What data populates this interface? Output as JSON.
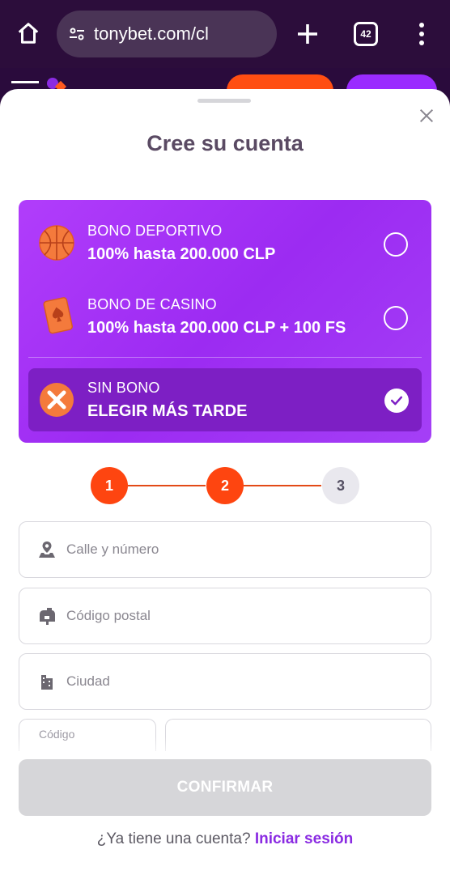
{
  "browser": {
    "url": "tonybet.com/cl",
    "tab_count": "42"
  },
  "modal": {
    "title": "Cree su cuenta"
  },
  "bonuses": [
    {
      "label": "BONO DEPORTIVO",
      "value": "100% hasta 200.000 CLP",
      "icon": "basketball-icon",
      "selected": false
    },
    {
      "label": "BONO DE CASINO",
      "value": "100% hasta 200.000 CLP + 100 FS",
      "icon": "playing-card-icon",
      "selected": false
    },
    {
      "label": "SIN BONO",
      "value": "ELEGIR MÁS TARDE",
      "icon": "no-bonus-icon",
      "selected": true
    }
  ],
  "stepper": {
    "steps": [
      "1",
      "2",
      "3"
    ],
    "current": 2
  },
  "form": {
    "street_placeholder": "Calle y número",
    "postal_placeholder": "Código postal",
    "city_placeholder": "Ciudad",
    "code_label": "Código"
  },
  "footer": {
    "confirm_label": "CONFIRMAR",
    "have_account": "¿Ya tiene una cuenta?",
    "login_link": "Iniciar sesión"
  },
  "colors": {
    "accent_purple": "#9c2bf2",
    "accent_orange": "#fe4510",
    "browser_bg": "#2c0d3b"
  }
}
